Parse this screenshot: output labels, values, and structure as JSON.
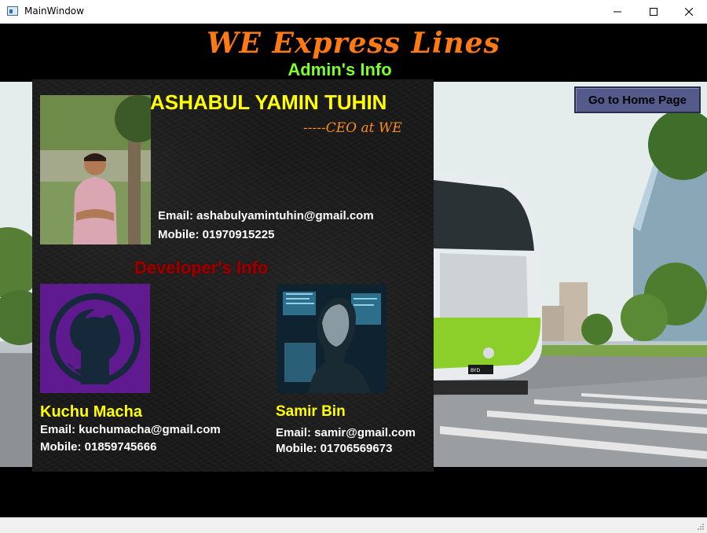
{
  "window": {
    "title": "MainWindow"
  },
  "header": {
    "title": "WE Express Lines",
    "subtitle": "Admin's Info"
  },
  "nav": {
    "home_label": "Go to Home Page"
  },
  "ceo": {
    "name": "ASHABUL YAMIN TUHIN",
    "role": "-----CEO at WE",
    "email": "Email: ashabulyamintuhin@gmail.com",
    "mobile": "Mobile: 01970915225"
  },
  "developers": {
    "heading": "Developer's Info",
    "items": [
      {
        "name": "Kuchu Macha",
        "email": "Email: kuchumacha@gmail.com",
        "mobile": "Mobile: 01859745666",
        "avatar": "github-icon"
      },
      {
        "name": "Samir Bin",
        "email": "Email: samir@gmail.com",
        "mobile": "Mobile: 01706569673",
        "avatar": "photo"
      }
    ]
  },
  "colors": {
    "title": "#ff7a12",
    "subtitle": "#7dff2a",
    "name": "#ffff00",
    "role": "#ff8c1a",
    "dev_heading": "#9b0000",
    "button": "#545a8a",
    "github_bg": "#5f1a8f"
  }
}
